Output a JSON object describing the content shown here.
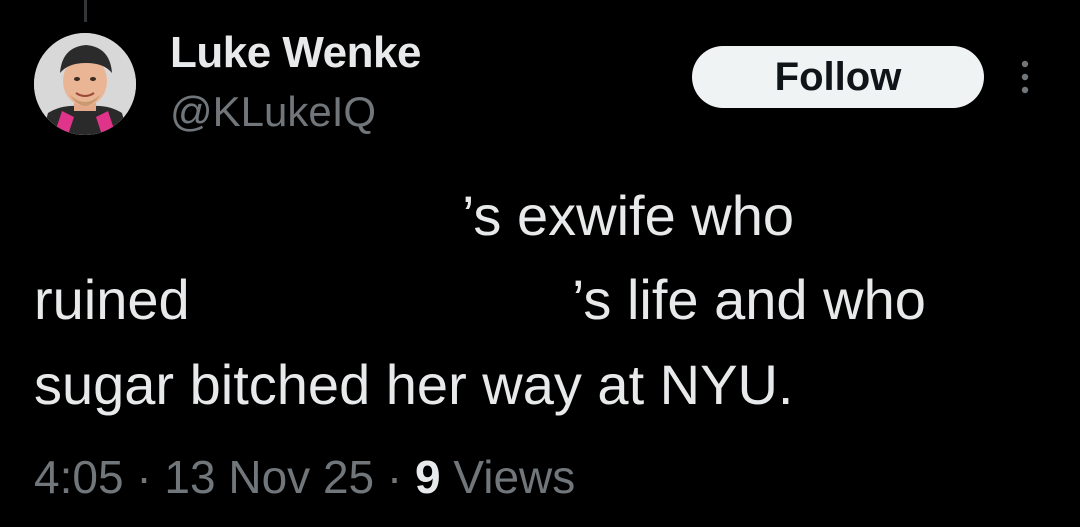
{
  "author": {
    "display_name": "Luke Wenke",
    "handle": "@KLukeIQ"
  },
  "follow_button": {
    "label": "Follow"
  },
  "more_menu": {
    "icon": "more-vertical-icon"
  },
  "tweet": {
    "line1_visible": "’s exwife who",
    "line2_start": "ruined",
    "line2_end": "’s life and who",
    "line3": "sugar bitched her way at NYU."
  },
  "meta": {
    "time": "4:05",
    "separator": "·",
    "date": "13 Nov 25",
    "views_count": "9",
    "views_label": "Views"
  },
  "colors": {
    "background": "#000000",
    "primary_text": "#e7e9ea",
    "secondary_text": "#71767b",
    "button_bg": "#eff3f4",
    "button_text": "#0f1419"
  }
}
